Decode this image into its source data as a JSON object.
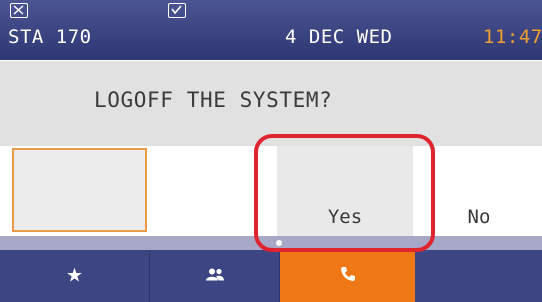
{
  "status_bar": {
    "station": "STA 170",
    "date": "4 DEC WED",
    "time": "11:47",
    "time_color": "#f0a030",
    "icons": [
      "missed-call-icon",
      "voicemail-icon"
    ]
  },
  "dialog": {
    "prompt": "LOGOFF THE SYSTEM?"
  },
  "softkeys": {
    "items": [
      {
        "label": "",
        "state": "focused"
      },
      {
        "label": "Yes",
        "state": "highlighted"
      },
      {
        "label": "No",
        "state": "normal"
      }
    ]
  },
  "tabs": [
    {
      "icon": "star-icon",
      "glyph": "★",
      "active": false
    },
    {
      "icon": "contacts-icon",
      "glyph": "👥",
      "active": false
    },
    {
      "icon": "phone-icon",
      "glyph": "📞",
      "active": true
    },
    {
      "icon": "",
      "glyph": "",
      "active": false
    }
  ],
  "colors": {
    "status_bar": "#3a4280",
    "tab_bar": "#3d4582",
    "active_tab": "#ee7716",
    "focus_border": "#ed9a48",
    "annotation": "#e0242d"
  }
}
